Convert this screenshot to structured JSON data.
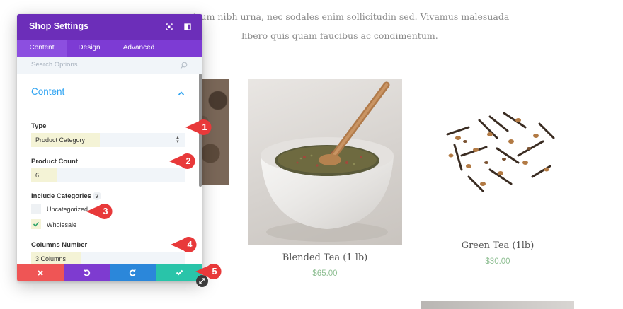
{
  "background_page": {
    "intro_line1": "se rutrum nibh urna, nec sodales enim sollicitudin sed. Vivamus malesuada",
    "intro_line2": "libero quis quam faucibus ac condimentum.",
    "products": [
      {
        "name": "Blended Tea (1 lb)",
        "price": "$65.00"
      },
      {
        "name": "Green Tea (1lb)",
        "price": "$30.00"
      }
    ]
  },
  "modal": {
    "title": "Shop Settings",
    "header_icons": [
      "fullscreen-icon",
      "split-view-icon"
    ],
    "tabs": [
      {
        "label": "Content",
        "active": true
      },
      {
        "label": "Design",
        "active": false
      },
      {
        "label": "Advanced",
        "active": false
      }
    ],
    "search": {
      "placeholder": "Search Options",
      "icon": "search-icon"
    },
    "section": {
      "title": "Content",
      "expanded": true
    },
    "fields": {
      "type": {
        "label": "Type",
        "value": "Product Category"
      },
      "product_count": {
        "label": "Product Count",
        "value": "6"
      },
      "include_categories": {
        "label": "Include Categories",
        "help": "?",
        "options": [
          {
            "label": "Uncategorized",
            "checked": false
          },
          {
            "label": "Wholesale",
            "checked": true
          }
        ]
      },
      "columns_number": {
        "label": "Columns Number",
        "value": "3 Columns"
      }
    },
    "footer_buttons": [
      {
        "name": "discard",
        "icon": "close-icon",
        "color": "#ef5555"
      },
      {
        "name": "undo",
        "icon": "undo-icon",
        "color": "#7e3bd0"
      },
      {
        "name": "redo",
        "icon": "redo-icon",
        "color": "#2b87da"
      },
      {
        "name": "save",
        "icon": "check-icon",
        "color": "#29c4a9"
      }
    ]
  },
  "callouts": [
    "1",
    "2",
    "3",
    "4",
    "5"
  ],
  "colors": {
    "header_purple": "#6c2eb9",
    "tab_purple": "#7d3bd4",
    "accent_blue": "#2ea3f2",
    "callout_red": "#e8393a",
    "price_green": "#8fbf93",
    "highlight_yellow": "#f4f3d6"
  }
}
